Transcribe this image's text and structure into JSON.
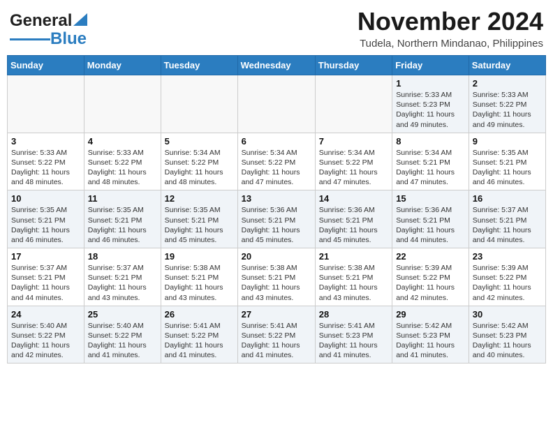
{
  "header": {
    "logo_line1": "General",
    "logo_line2": "Blue",
    "month": "November 2024",
    "location": "Tudela, Northern Mindanao, Philippines"
  },
  "weekdays": [
    "Sunday",
    "Monday",
    "Tuesday",
    "Wednesday",
    "Thursday",
    "Friday",
    "Saturday"
  ],
  "weeks": [
    [
      {
        "day": "",
        "info": ""
      },
      {
        "day": "",
        "info": ""
      },
      {
        "day": "",
        "info": ""
      },
      {
        "day": "",
        "info": ""
      },
      {
        "day": "",
        "info": ""
      },
      {
        "day": "1",
        "info": "Sunrise: 5:33 AM\nSunset: 5:23 PM\nDaylight: 11 hours and 49 minutes."
      },
      {
        "day": "2",
        "info": "Sunrise: 5:33 AM\nSunset: 5:22 PM\nDaylight: 11 hours and 49 minutes."
      }
    ],
    [
      {
        "day": "3",
        "info": "Sunrise: 5:33 AM\nSunset: 5:22 PM\nDaylight: 11 hours and 48 minutes."
      },
      {
        "day": "4",
        "info": "Sunrise: 5:33 AM\nSunset: 5:22 PM\nDaylight: 11 hours and 48 minutes."
      },
      {
        "day": "5",
        "info": "Sunrise: 5:34 AM\nSunset: 5:22 PM\nDaylight: 11 hours and 48 minutes."
      },
      {
        "day": "6",
        "info": "Sunrise: 5:34 AM\nSunset: 5:22 PM\nDaylight: 11 hours and 47 minutes."
      },
      {
        "day": "7",
        "info": "Sunrise: 5:34 AM\nSunset: 5:22 PM\nDaylight: 11 hours and 47 minutes."
      },
      {
        "day": "8",
        "info": "Sunrise: 5:34 AM\nSunset: 5:21 PM\nDaylight: 11 hours and 47 minutes."
      },
      {
        "day": "9",
        "info": "Sunrise: 5:35 AM\nSunset: 5:21 PM\nDaylight: 11 hours and 46 minutes."
      }
    ],
    [
      {
        "day": "10",
        "info": "Sunrise: 5:35 AM\nSunset: 5:21 PM\nDaylight: 11 hours and 46 minutes."
      },
      {
        "day": "11",
        "info": "Sunrise: 5:35 AM\nSunset: 5:21 PM\nDaylight: 11 hours and 46 minutes."
      },
      {
        "day": "12",
        "info": "Sunrise: 5:35 AM\nSunset: 5:21 PM\nDaylight: 11 hours and 45 minutes."
      },
      {
        "day": "13",
        "info": "Sunrise: 5:36 AM\nSunset: 5:21 PM\nDaylight: 11 hours and 45 minutes."
      },
      {
        "day": "14",
        "info": "Sunrise: 5:36 AM\nSunset: 5:21 PM\nDaylight: 11 hours and 45 minutes."
      },
      {
        "day": "15",
        "info": "Sunrise: 5:36 AM\nSunset: 5:21 PM\nDaylight: 11 hours and 44 minutes."
      },
      {
        "day": "16",
        "info": "Sunrise: 5:37 AM\nSunset: 5:21 PM\nDaylight: 11 hours and 44 minutes."
      }
    ],
    [
      {
        "day": "17",
        "info": "Sunrise: 5:37 AM\nSunset: 5:21 PM\nDaylight: 11 hours and 44 minutes."
      },
      {
        "day": "18",
        "info": "Sunrise: 5:37 AM\nSunset: 5:21 PM\nDaylight: 11 hours and 43 minutes."
      },
      {
        "day": "19",
        "info": "Sunrise: 5:38 AM\nSunset: 5:21 PM\nDaylight: 11 hours and 43 minutes."
      },
      {
        "day": "20",
        "info": "Sunrise: 5:38 AM\nSunset: 5:21 PM\nDaylight: 11 hours and 43 minutes."
      },
      {
        "day": "21",
        "info": "Sunrise: 5:38 AM\nSunset: 5:21 PM\nDaylight: 11 hours and 43 minutes."
      },
      {
        "day": "22",
        "info": "Sunrise: 5:39 AM\nSunset: 5:22 PM\nDaylight: 11 hours and 42 minutes."
      },
      {
        "day": "23",
        "info": "Sunrise: 5:39 AM\nSunset: 5:22 PM\nDaylight: 11 hours and 42 minutes."
      }
    ],
    [
      {
        "day": "24",
        "info": "Sunrise: 5:40 AM\nSunset: 5:22 PM\nDaylight: 11 hours and 42 minutes."
      },
      {
        "day": "25",
        "info": "Sunrise: 5:40 AM\nSunset: 5:22 PM\nDaylight: 11 hours and 41 minutes."
      },
      {
        "day": "26",
        "info": "Sunrise: 5:41 AM\nSunset: 5:22 PM\nDaylight: 11 hours and 41 minutes."
      },
      {
        "day": "27",
        "info": "Sunrise: 5:41 AM\nSunset: 5:22 PM\nDaylight: 11 hours and 41 minutes."
      },
      {
        "day": "28",
        "info": "Sunrise: 5:41 AM\nSunset: 5:23 PM\nDaylight: 11 hours and 41 minutes."
      },
      {
        "day": "29",
        "info": "Sunrise: 5:42 AM\nSunset: 5:23 PM\nDaylight: 11 hours and 41 minutes."
      },
      {
        "day": "30",
        "info": "Sunrise: 5:42 AM\nSunset: 5:23 PM\nDaylight: 11 hours and 40 minutes."
      }
    ]
  ]
}
